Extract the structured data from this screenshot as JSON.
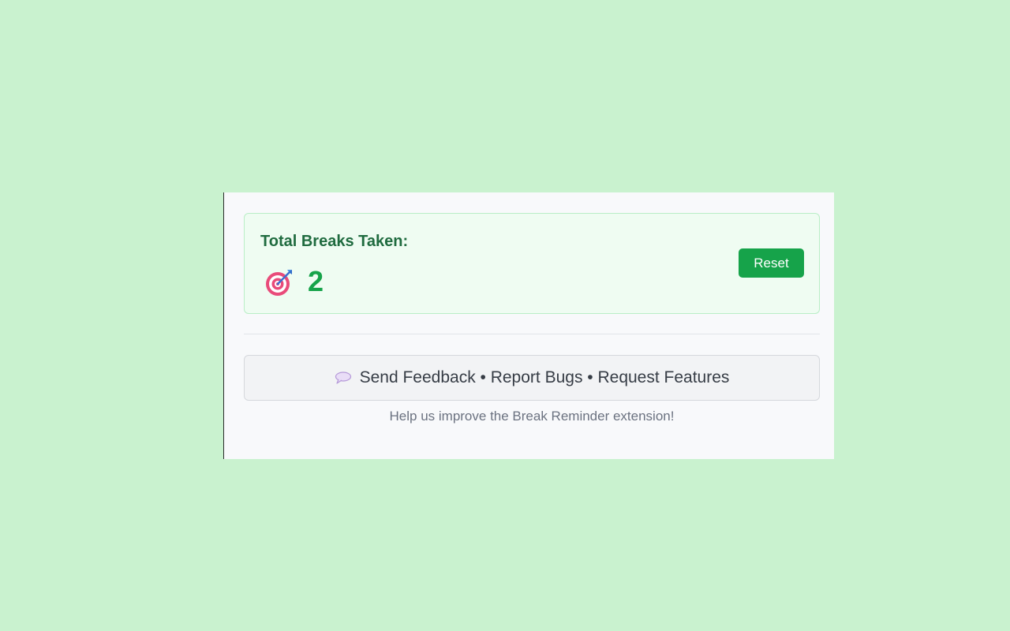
{
  "stats": {
    "label": "Total Breaks Taken:",
    "count": "2",
    "icon": "target-icon"
  },
  "actions": {
    "reset_label": "Reset"
  },
  "feedback": {
    "icon": "speech-bubble-icon",
    "button_label": "Send Feedback • Report Bugs • Request Features",
    "help_text": "Help us improve the Break Reminder extension!"
  },
  "colors": {
    "background": "#c9f2cf",
    "accent": "#16a34a",
    "card_background": "#effcf2",
    "label_text": "#1f6b3f"
  }
}
